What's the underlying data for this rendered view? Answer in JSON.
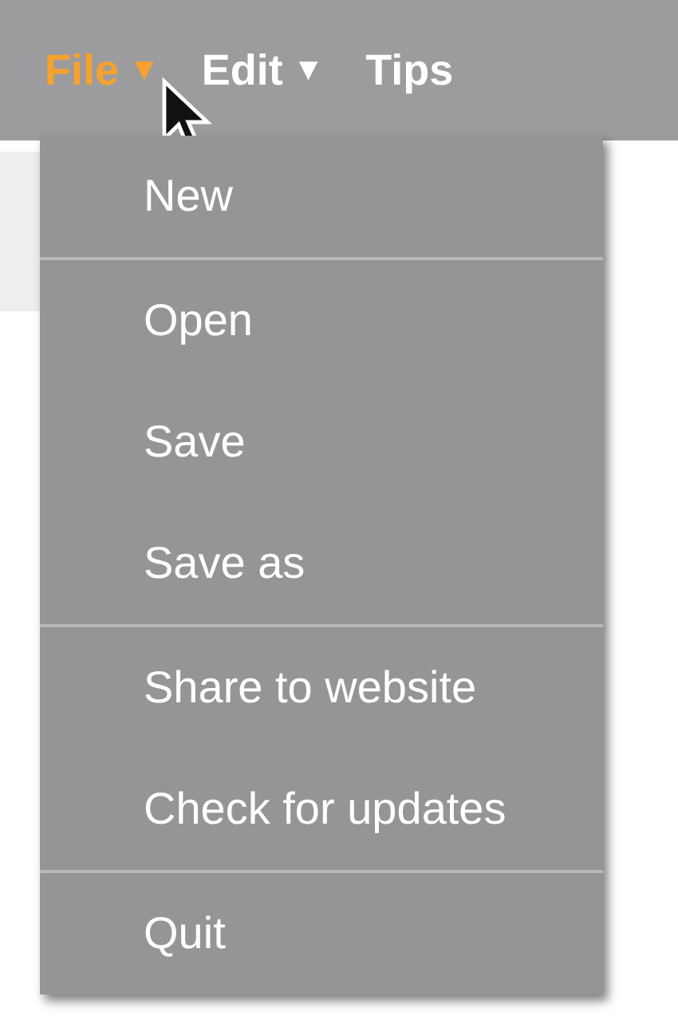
{
  "menubar": [
    {
      "label": "File",
      "arrow": "▼",
      "selected": true
    },
    {
      "label": "Edit",
      "arrow": "▼",
      "selected": false
    },
    {
      "label": "Tips",
      "selected": false
    }
  ],
  "menu": {
    "groups": [
      [
        "New"
      ],
      [
        "Open",
        "Save",
        "Save as"
      ],
      [
        "Share to website",
        "Check for updates"
      ],
      [
        "Quit"
      ]
    ]
  }
}
